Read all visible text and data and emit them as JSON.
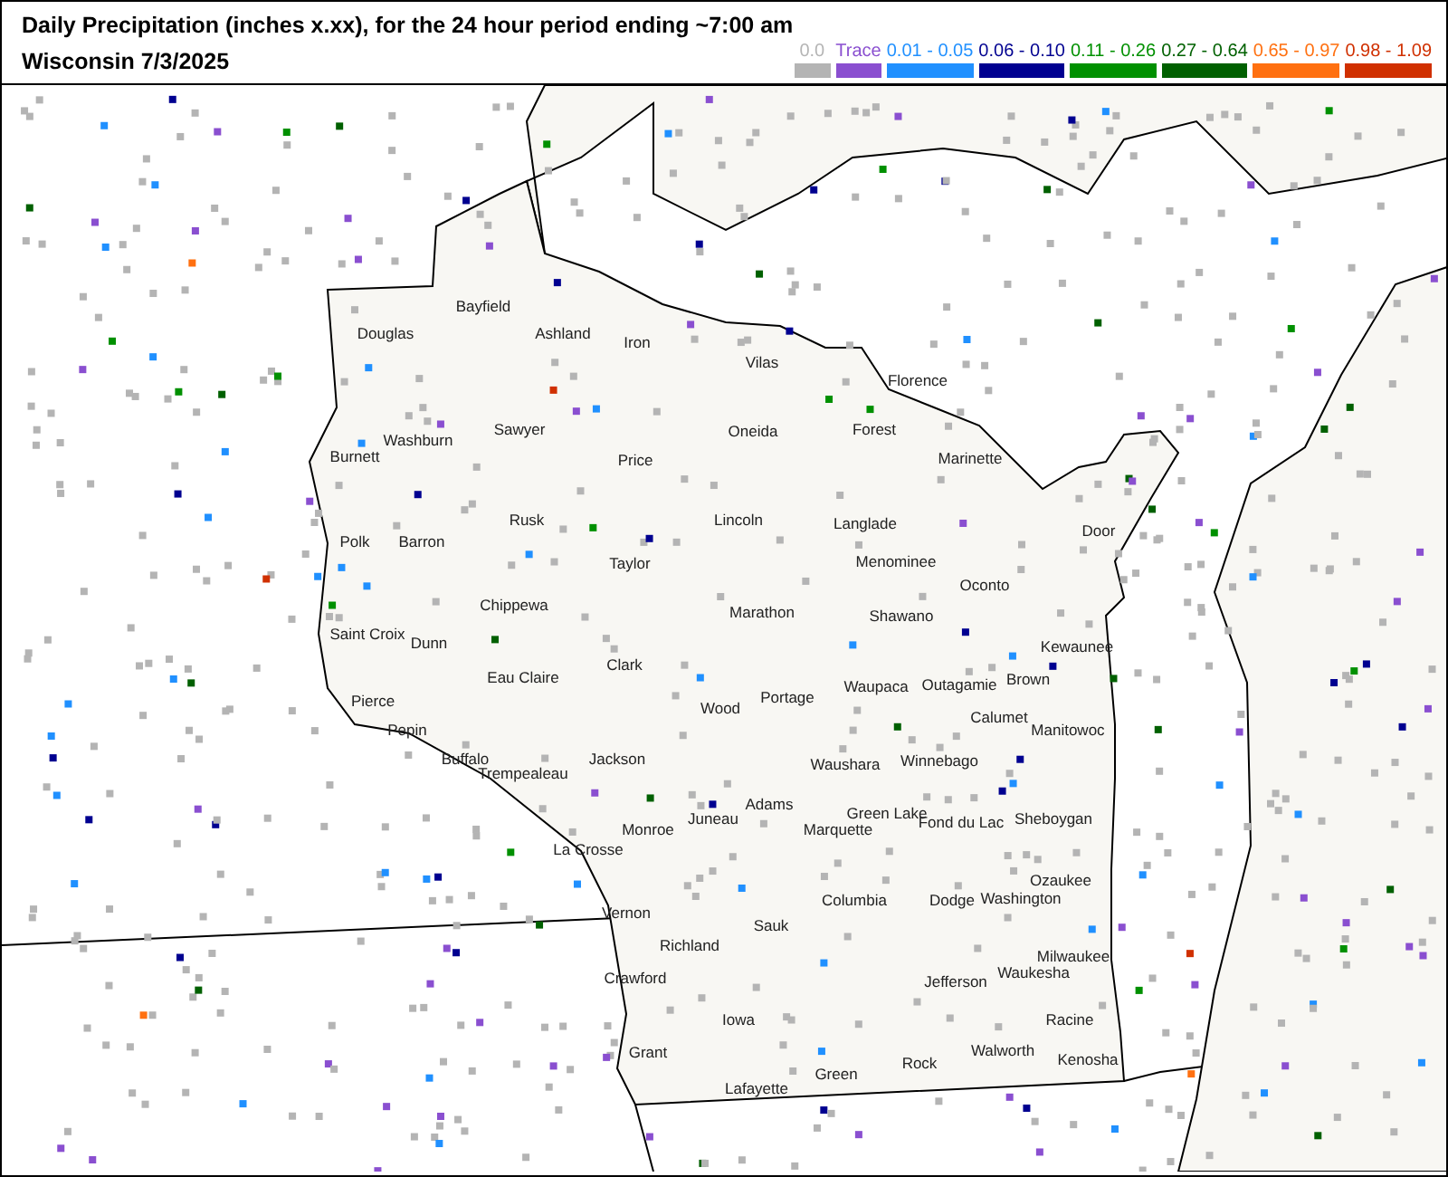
{
  "title": "Daily Precipitation (inches  x.xx),  for the 24 hour period ending ~7:00 am",
  "subtitle": "Wisconsin 7/3/2025",
  "legend": [
    {
      "label": "0.0",
      "color": "#b4b4b4"
    },
    {
      "label": "Trace",
      "color": "#8a4fd0"
    },
    {
      "label": "0.01 - 0.05",
      "color": "#2090ff"
    },
    {
      "label": "0.06 - 0.10",
      "color": "#000090"
    },
    {
      "label": "0.11 - 0.26",
      "color": "#009000"
    },
    {
      "label": "0.27 - 0.64",
      "color": "#006000"
    },
    {
      "label": "0.65 - 0.97",
      "color": "#ff7010"
    },
    {
      "label": "0.98 - 1.09",
      "color": "#d03000"
    }
  ],
  "counties": [
    "Douglas",
    "Bayfield",
    "Ashland",
    "Iron",
    "Vilas",
    "Florence",
    "Burnett",
    "Washburn",
    "Sawyer",
    "Price",
    "Oneida",
    "Forest",
    "Marinette",
    "Polk",
    "Barron",
    "Rusk",
    "Lincoln",
    "Langlade",
    "Taylor",
    "Menominee",
    "Oconto",
    "Chippewa",
    "Marathon",
    "Shawano",
    "Saint Croix",
    "Dunn",
    "Clark",
    "Kewaunee",
    "Eau Claire",
    "Waupaca",
    "Outagamie",
    "Brown",
    "Pierce",
    "Wood",
    "Portage",
    "Calumet",
    "Door",
    "Manitowoc",
    "Pepin",
    "Buffalo",
    "Trempealeau",
    "Jackson",
    "Waushara",
    "Winnebago",
    "Adams",
    "Juneau",
    "Marquette",
    "Green Lake",
    "Fond du Lac",
    "Sheboygan",
    "Monroe",
    "La Crosse",
    "Ozaukee",
    "Columbia",
    "Dodge",
    "Washington",
    "Vernon",
    "Sauk",
    "Richland",
    "Milwaukee",
    "Waukesha",
    "Jefferson",
    "Crawford",
    "Iowa",
    "Racine",
    "Grant",
    "Walworth",
    "Kenosha",
    "Green",
    "Rock",
    "Lafayette"
  ]
}
